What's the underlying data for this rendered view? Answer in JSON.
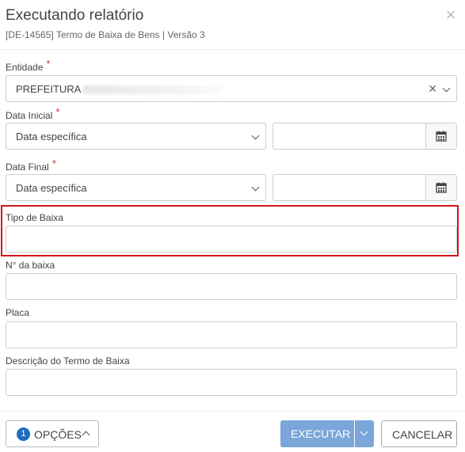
{
  "header": {
    "title": "Executando relatório",
    "subtitle": "[DE-14565] Termo de Baixa de Bens | Versão 3",
    "close_icon": "close-icon"
  },
  "form": {
    "entidade": {
      "label": "Entidade",
      "required_mark": "*",
      "value": "PREFEITURA"
    },
    "data_inicial": {
      "label": "Data Inicial",
      "required_mark": "*",
      "select_value": "Data específica",
      "date_value": ""
    },
    "data_final": {
      "label": "Data Final",
      "required_mark": "*",
      "select_value": "Data específica",
      "date_value": ""
    },
    "tipo_baixa": {
      "label": "Tipo de Baixa",
      "value": ""
    },
    "numero_baixa": {
      "label": "N° da baixa",
      "value": ""
    },
    "placa": {
      "label": "Placa",
      "value": ""
    },
    "descricao": {
      "label": "Descrição do Termo de Baixa",
      "value": ""
    }
  },
  "footer": {
    "options_count": "1",
    "options_label": "OPÇÕES",
    "execute_label": "EXECUTAR",
    "cancel_label": "CANCELAR"
  },
  "colors": {
    "highlight": "#d5141c",
    "required": "#d9342b",
    "primary_disabled": "#7aa6d9",
    "badge": "#1f6dbf"
  }
}
